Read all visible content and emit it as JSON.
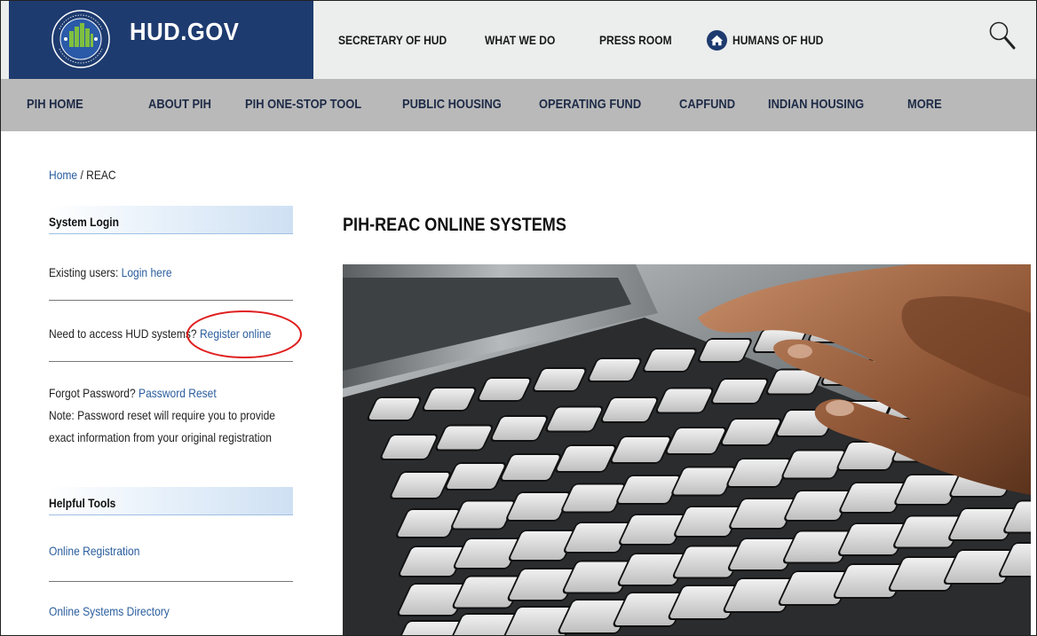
{
  "header": {
    "brand": "HUD.GOV",
    "links": [
      {
        "label": "SECRETARY OF HUD"
      },
      {
        "label": "WHAT WE DO"
      },
      {
        "label": "PRESS ROOM"
      },
      {
        "label": "HUMANS OF HUD"
      }
    ]
  },
  "pih_nav": {
    "items": [
      {
        "label": "PIH HOME"
      },
      {
        "label": "ABOUT PIH"
      },
      {
        "label": "PIH ONE-STOP TOOL"
      },
      {
        "label": "PUBLIC HOUSING"
      },
      {
        "label": "OPERATING FUND"
      },
      {
        "label": "CAPFUND"
      },
      {
        "label": "INDIAN HOUSING"
      },
      {
        "label": "MORE"
      }
    ]
  },
  "breadcrumb": {
    "home": "Home",
    "separator": " / ",
    "current": "REAC"
  },
  "sidebar": {
    "system_login": {
      "heading": "System Login",
      "existing_prefix": "Existing users: ",
      "existing_link": "Login here",
      "need_prefix": "Need to access HUD systems? ",
      "need_link": "Register online",
      "forgot_prefix": "Forgot Password? ",
      "forgot_link": "Password Reset",
      "note_line1": "Note: Password reset will require you to provide",
      "note_line2": "exact information from your original registration"
    },
    "helpful_tools": {
      "heading": "Helpful Tools",
      "links": [
        "Online Registration",
        "Online Systems Directory"
      ]
    }
  },
  "main": {
    "title": "PIH-REAC ONLINE SYSTEMS"
  },
  "colors": {
    "hud_blue": "#1e3b6f",
    "link_blue": "#2b5e9e",
    "nav_gray": "#b9b9b9",
    "annotation_red": "#e01f1f"
  },
  "icons": {
    "seal": "hud-seal-icon",
    "home": "home-icon",
    "search": "search-icon"
  }
}
